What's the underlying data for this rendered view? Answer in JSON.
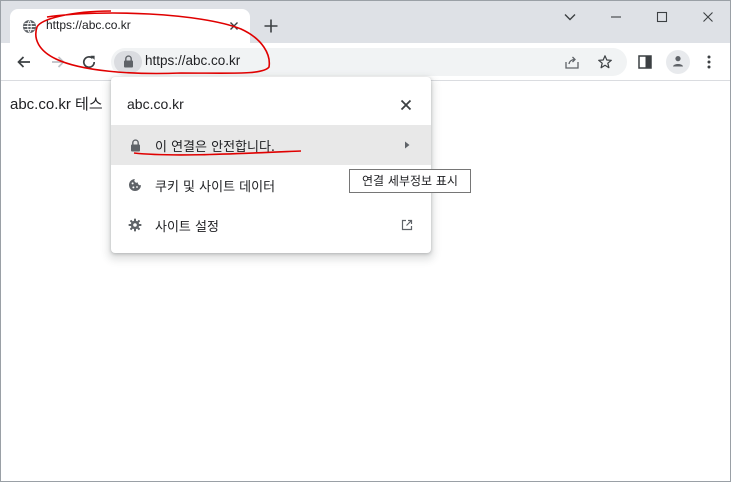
{
  "tab": {
    "title": "https://abc.co.kr"
  },
  "omnibox": {
    "url": "https://abc.co.kr"
  },
  "page": {
    "text": "abc.co.kr 테스"
  },
  "popup": {
    "site": "abc.co.kr",
    "rows": [
      {
        "label": "이 연결은 안전합니다.",
        "icon": "lock-icon",
        "trail": "arrow-right-icon"
      },
      {
        "label": "쿠키 및 사이트 데이터",
        "icon": "cookie-icon"
      },
      {
        "label": "사이트 설정",
        "icon": "gear-icon",
        "trail": "open-external-icon"
      }
    ]
  },
  "tooltip": {
    "text": "연결 세부정보 표시"
  },
  "colors": {
    "annotation": "#e00000",
    "tab_strip": "#dee1e6",
    "highlight_row": "#e8e8e8"
  }
}
